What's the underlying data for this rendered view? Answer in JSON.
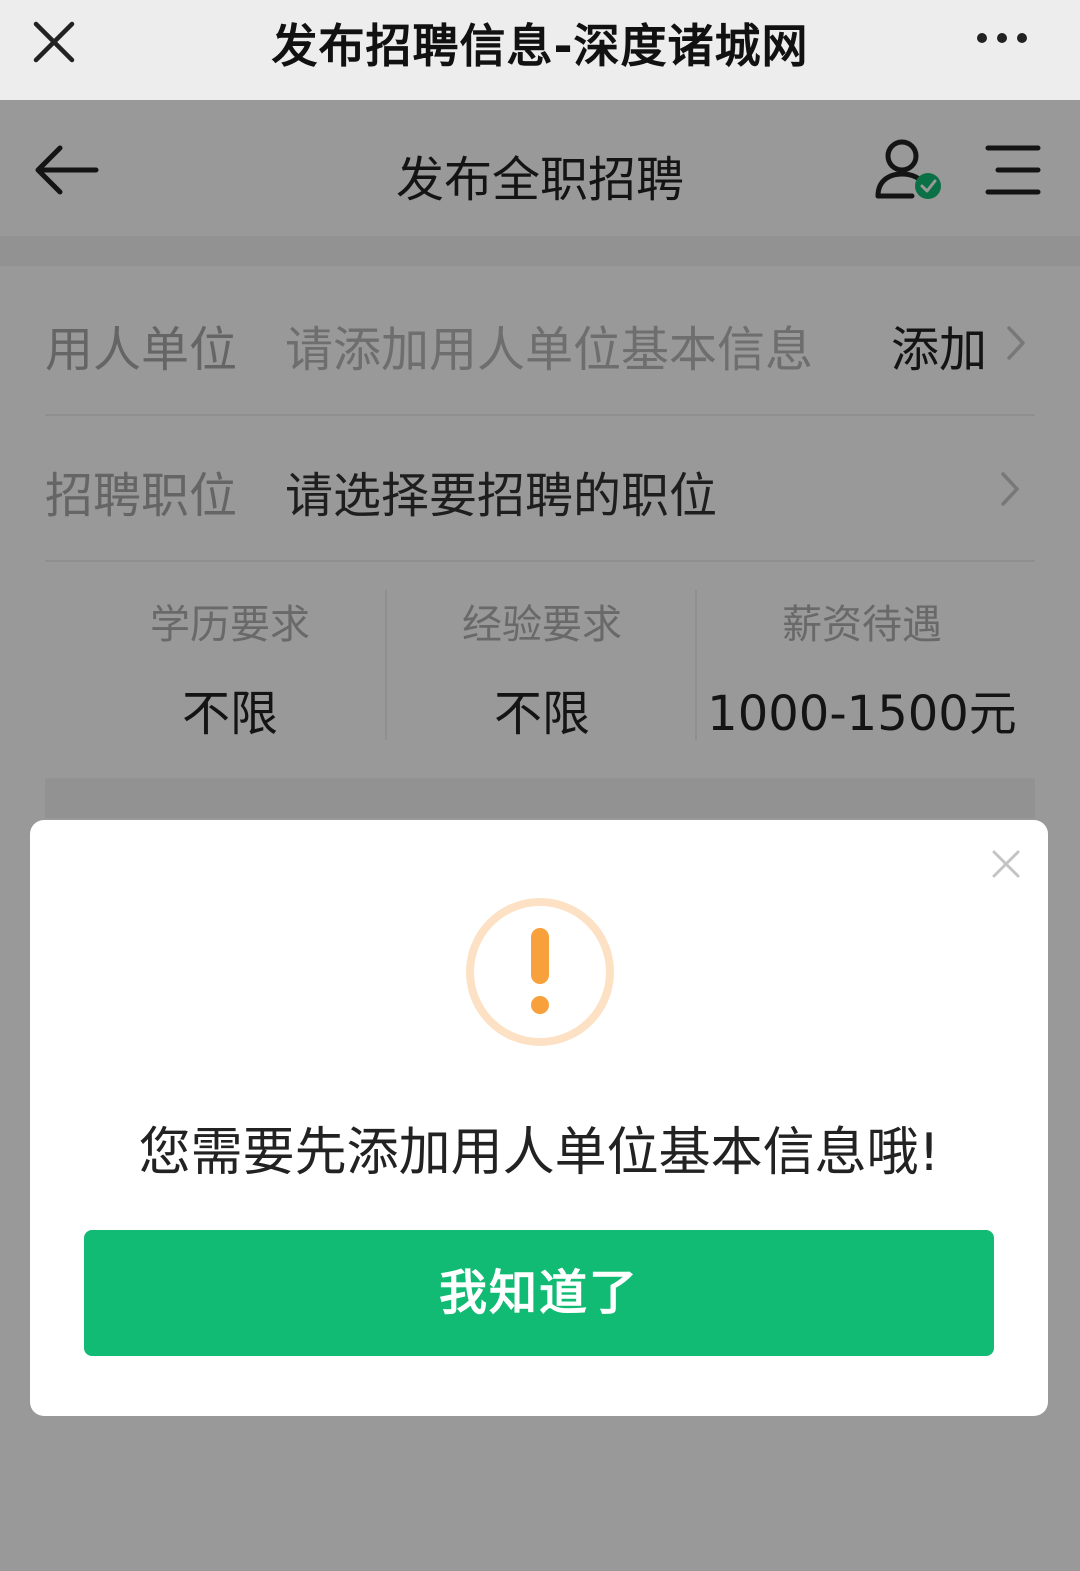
{
  "browser": {
    "title": "发布招聘信息-深度诸城网"
  },
  "header": {
    "title": "发布全职招聘"
  },
  "form": {
    "employer": {
      "label": "用人单位",
      "placeholder": "请添加用人单位基本信息",
      "action": "添加"
    },
    "position": {
      "label": "招聘职位",
      "placeholder": "请选择要招聘的职位"
    },
    "requirements": [
      {
        "label": "学历要求",
        "value": "不限"
      },
      {
        "label": "经验要求",
        "value": "不限"
      },
      {
        "label": "薪资待遇",
        "value": "1000-1500元"
      }
    ]
  },
  "dialog": {
    "message": "您需要先添加用人单位基本信息哦!",
    "button": "我知道了"
  },
  "colors": {
    "accent": "#12bb74",
    "warning": "#f7a03c",
    "badge": "#12bb74"
  },
  "icons": [
    "close-icon",
    "more-icon",
    "back-arrow-icon",
    "user-verified-icon",
    "menu-icon",
    "chevron-right-icon",
    "warning-icon"
  ]
}
